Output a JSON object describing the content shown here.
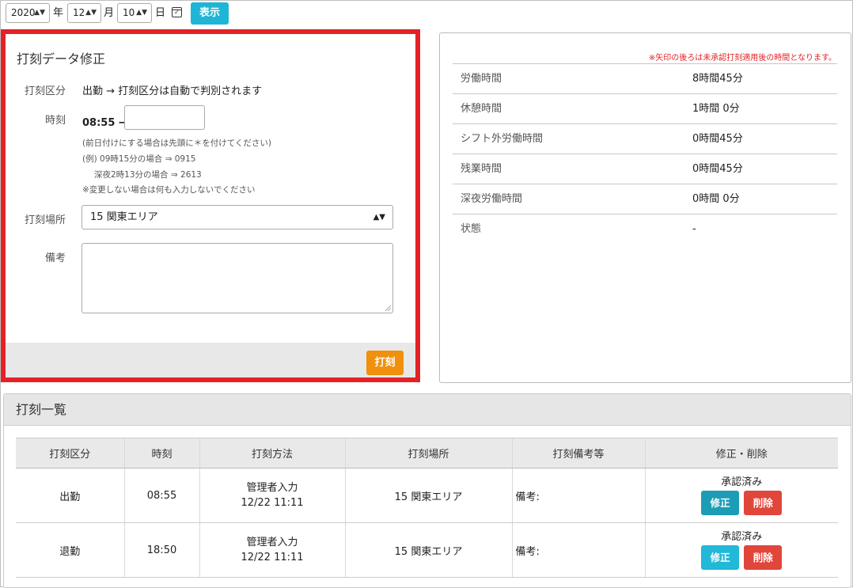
{
  "datebar": {
    "year": "2020",
    "year_unit": "年",
    "month": "12",
    "month_unit": "月",
    "day": "10",
    "day_unit": "日",
    "show_button": "表示"
  },
  "edit": {
    "title": "打刻データ修正",
    "type_label": "打刻区分",
    "type_value": "出勤 → 打刻区分は自動で判別されます",
    "time_label": "時刻",
    "time_value": "08:55 →",
    "time_input_value": "",
    "hints": [
      "(前日付けにする場合は先頭に＊を付けてください)",
      "(例) 09時15分の場合 ⇒ 0915",
      "深夜2時13分の場合 ⇒ 2613",
      "※変更しない場合は何も入力しないでください"
    ],
    "place_label": "打刻場所",
    "place_value": "15 関東エリア",
    "memo_label": "備考",
    "memo_value": "",
    "stamp_button": "打刻"
  },
  "summary": {
    "note": "※矢印の後ろは未承認打刻適用後の時間となります。",
    "rows": [
      {
        "key": "労働時間",
        "value": "8時間45分"
      },
      {
        "key": "休憩時間",
        "value": "1時間 0分"
      },
      {
        "key": "シフト外労働時間",
        "value": "0時間45分"
      },
      {
        "key": "残業時間",
        "value": "0時間45分"
      },
      {
        "key": "深夜労働時間",
        "value": "0時間 0分"
      },
      {
        "key": "状態",
        "value": "-"
      }
    ]
  },
  "list": {
    "title": "打刻一覧",
    "columns": [
      "打刻区分",
      "時刻",
      "打刻方法",
      "打刻場所",
      "打刻備考等",
      "修正・削除"
    ],
    "rows": [
      {
        "type": "出勤",
        "time": "08:55",
        "method": "管理者入力",
        "method_time": "12/22 11:11",
        "place": "15 関東エリア",
        "memo": "備考:",
        "status": "承認済み",
        "fix": "修正",
        "delete": "削除"
      },
      {
        "type": "退勤",
        "time": "18:50",
        "method": "管理者入力",
        "method_time": "12/22 11:11",
        "place": "15 関東エリア",
        "memo": "備考:",
        "status": "承認済み",
        "fix": "修正",
        "delete": "削除"
      }
    ]
  },
  "colors": {
    "highlight_border": "#e32226",
    "show_button": "#1fb5d6",
    "stamp_button": "#f0900e",
    "fix_button": "#1b9db5",
    "delete_button": "#e0463a"
  }
}
